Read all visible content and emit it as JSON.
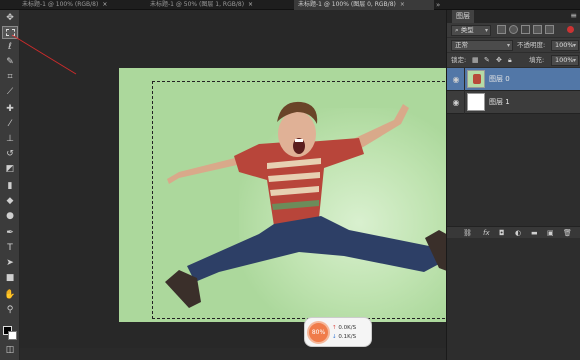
{
  "tabs": {
    "t1": "未标题-1 @ 100% (RGB/8)",
    "t2": "未标题-1 @ 50% (图层 1, RGB/8)",
    "t3": "未标题-1 @ 100% (图层 0, RGB/8)",
    "more": "»"
  },
  "hud": {
    "percent": "80%",
    "upload": "0.0K/S",
    "download": "0.1K/S"
  },
  "layers_panel": {
    "title": "图层",
    "filter_label": "类型",
    "blend_mode": "正常",
    "opacity_label": "不透明度:",
    "opacity_value": "100%",
    "lock_label": "锁定:",
    "fill_label": "填充:",
    "fill_value": "100%",
    "layers": [
      {
        "name": "图层 0",
        "active": true
      },
      {
        "name": "图层 1",
        "active": false
      }
    ]
  },
  "colors": {
    "accent_selection": "#5277a7",
    "annotation_red": "#cc2b2b",
    "canvas_bg": "#282828",
    "photo_bg": "#acd89c"
  },
  "icons": {
    "tools": [
      "move-icon",
      "marquee-icon",
      "lasso-icon",
      "quick-select-icon",
      "crop-icon",
      "eyedropper-icon",
      "healing-icon",
      "brush-icon",
      "stamp-icon",
      "history-brush-icon",
      "eraser-icon",
      "gradient-icon",
      "blur-icon",
      "dodge-icon",
      "pen-icon",
      "type-icon",
      "path-select-icon",
      "shape-icon",
      "hand-icon",
      "zoom-icon"
    ]
  }
}
